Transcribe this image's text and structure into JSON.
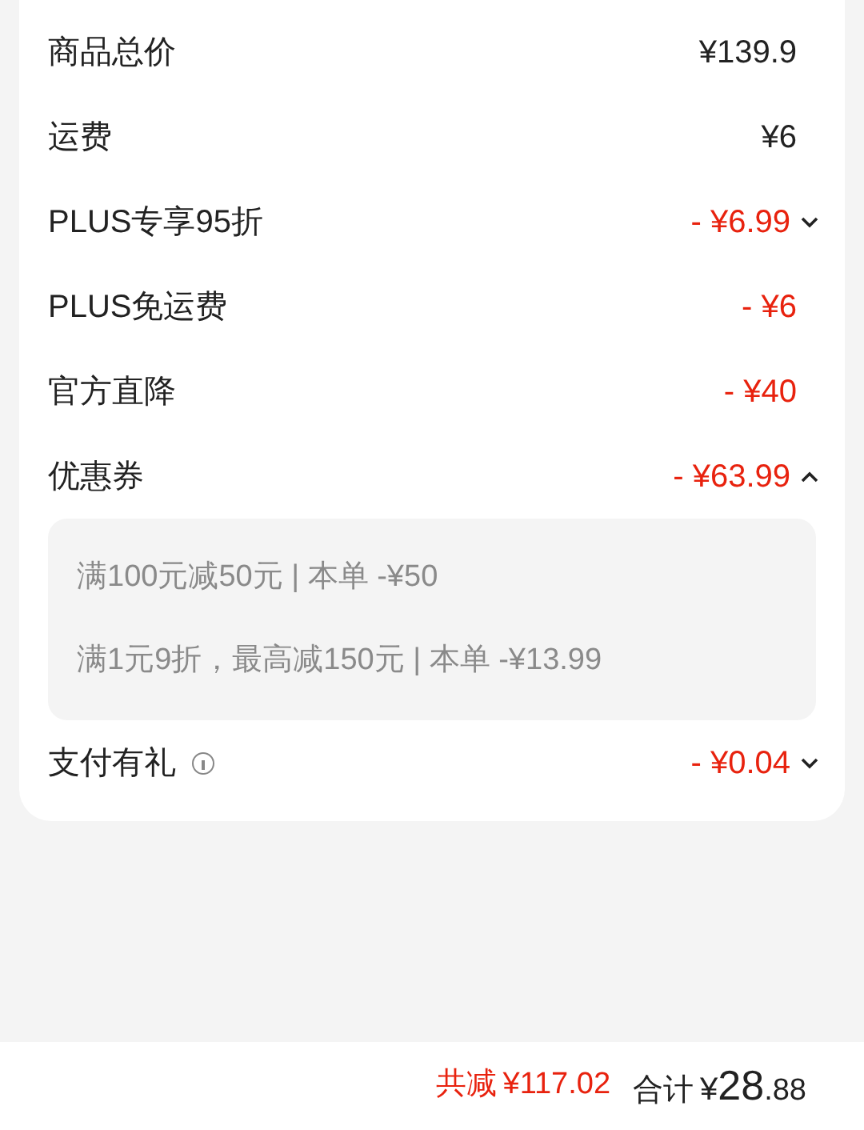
{
  "price_rows": [
    {
      "label": "商品总价",
      "value": "¥139.9",
      "kind": "amount"
    },
    {
      "label": "运费",
      "value": "¥6",
      "kind": "amount"
    },
    {
      "label": "PLUS专享95折",
      "value": "- ¥6.99",
      "kind": "discount",
      "expanded": false
    },
    {
      "label": "PLUS免运费",
      "value": "- ¥6",
      "kind": "discount"
    },
    {
      "label": "官方直降",
      "value": "- ¥40",
      "kind": "discount"
    },
    {
      "label": "优惠券",
      "value": "- ¥63.99",
      "kind": "discount",
      "expanded": true,
      "details": [
        "满100元减50元 | 本单 -¥50",
        "满1元9折，最高减150元 | 本单 -¥13.99"
      ]
    },
    {
      "label": "支付有礼",
      "value": "- ¥0.04",
      "kind": "discount",
      "info": true,
      "expanded": false
    }
  ],
  "footer": {
    "saved_label": "共减",
    "saved_value": "¥117.02",
    "total_label": "合计",
    "total_currency": "¥",
    "total_integer": "28",
    "total_decimal": ".88"
  }
}
